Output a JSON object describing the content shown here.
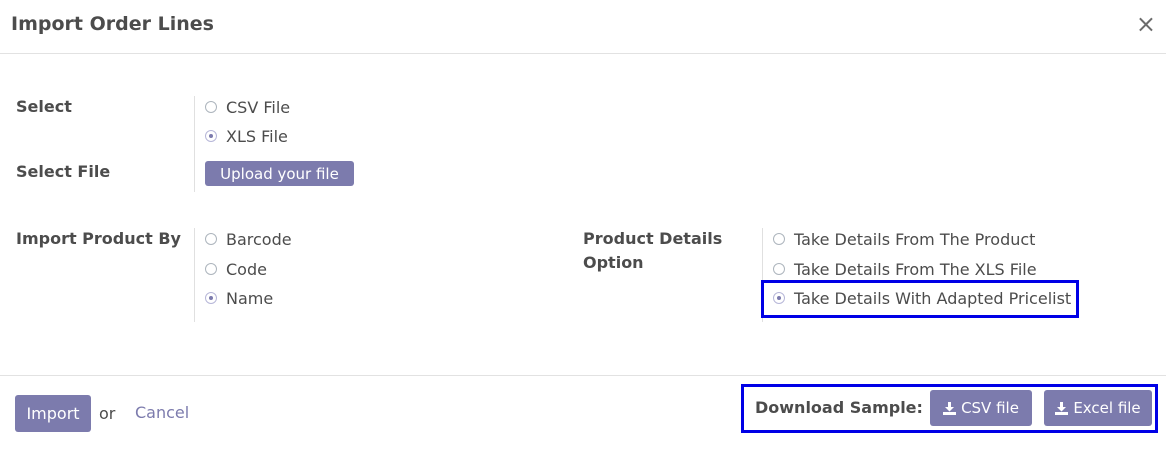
{
  "dialog": {
    "title": "Import Order Lines",
    "close_glyph": "×"
  },
  "select": {
    "label": "Select",
    "options": [
      {
        "label": "CSV File",
        "selected": false
      },
      {
        "label": "XLS File",
        "selected": true
      }
    ]
  },
  "select_file": {
    "label": "Select File",
    "upload_label": "Upload your file"
  },
  "import_product_by": {
    "label": "Import Product By",
    "options": [
      {
        "label": "Barcode",
        "selected": false
      },
      {
        "label": "Code",
        "selected": false
      },
      {
        "label": "Name",
        "selected": true
      }
    ]
  },
  "product_details": {
    "label_line1": "Product Details",
    "label_line2": "Option",
    "options": [
      {
        "label": "Take Details From The Product",
        "selected": false
      },
      {
        "label": "Take Details From The XLS File",
        "selected": false
      },
      {
        "label": "Take Details With Adapted Pricelist",
        "selected": true
      }
    ]
  },
  "footer": {
    "import_label": "Import",
    "or_label": "or",
    "cancel_label": "Cancel",
    "download_label": "Download Sample:",
    "csv_label": "CSV file",
    "excel_label": "Excel file"
  },
  "colors": {
    "accent": "#7c7bad",
    "highlight": "#0000e6"
  }
}
